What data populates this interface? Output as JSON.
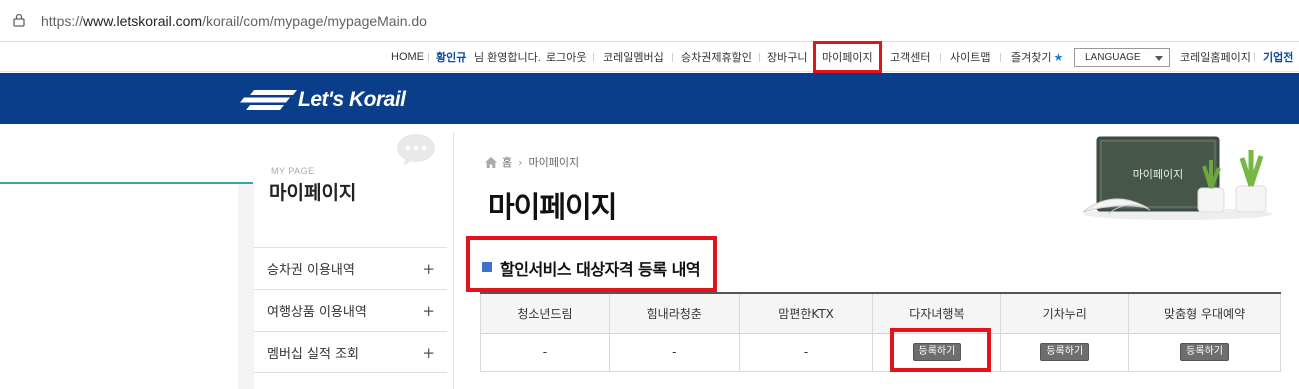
{
  "browser": {
    "url_prefix": "https://",
    "url_host": "www.letskorail.com",
    "url_path": "/korail/com/mypage/mypageMain.do"
  },
  "util_nav": {
    "home": "HOME",
    "user_name": "황인규",
    "welcome": "님 환영합니다.",
    "logout": "로그아웃",
    "membership": "코레일멤버십",
    "discount": "승차권제휴할인",
    "cart": "장바구니",
    "mypage": "마이페이지",
    "customer": "고객센터",
    "sitemap": "사이트맵",
    "favorites": "즐겨찾기",
    "language": "LANGUAGE",
    "korail_home": "코레일홈페이지",
    "corporate": "기업전"
  },
  "header": {
    "logo_text": "Let's Korail"
  },
  "sidebar": {
    "sub": "MY PAGE",
    "title": "마이페이지",
    "items": [
      {
        "label": "승차권 이용내역"
      },
      {
        "label": "여행상품 이용내역"
      },
      {
        "label": "멤버십 실적 조회"
      }
    ]
  },
  "breadcrumb": {
    "home": "홈",
    "current": "마이페이지"
  },
  "page_title": "마이페이지",
  "illustration_text": "마이페이지",
  "section": {
    "title": "할인서비스 대상자격 등록 내역",
    "columns": [
      "청소년드림",
      "힘내라청춘",
      "맘편한KTX",
      "다자녀행복",
      "기차누리",
      "맞춤형 우대예약"
    ],
    "values": [
      "-",
      "-",
      "-"
    ],
    "register_label": "등록하기"
  },
  "colors": {
    "header_blue": "#0a3e8a",
    "highlight_red": "#e3131b",
    "accent_teal": "#3aa6a3"
  }
}
